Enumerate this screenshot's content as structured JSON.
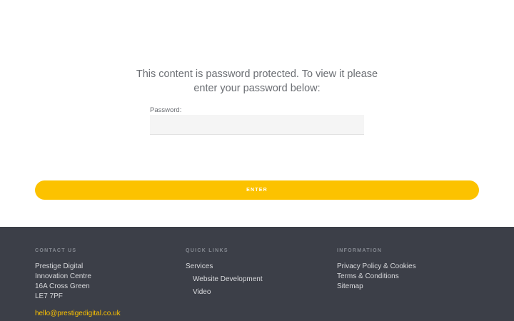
{
  "protected": {
    "message": "This content is password protected. To view it please enter your password below:",
    "password_label": "Password:",
    "password_value": "",
    "enter_label": "ENTER"
  },
  "footer": {
    "contact": {
      "heading": "CONTACT US",
      "address": [
        "Prestige Digital",
        "Innovation Centre",
        "16A Cross Green",
        "LE7 7PF"
      ],
      "email": "hello@prestigedigital.co.uk"
    },
    "quick_links": {
      "heading": "QUICK LINKS",
      "services": "Services",
      "website_development": "Website Development",
      "video": "Video"
    },
    "information": {
      "heading": "INFORMATION",
      "privacy": "Privacy Policy & Cookies",
      "terms": "Terms & Conditions",
      "sitemap": "Sitemap"
    }
  },
  "colors": {
    "accent": "#fcc200",
    "footer_bg": "#3c3f48"
  }
}
